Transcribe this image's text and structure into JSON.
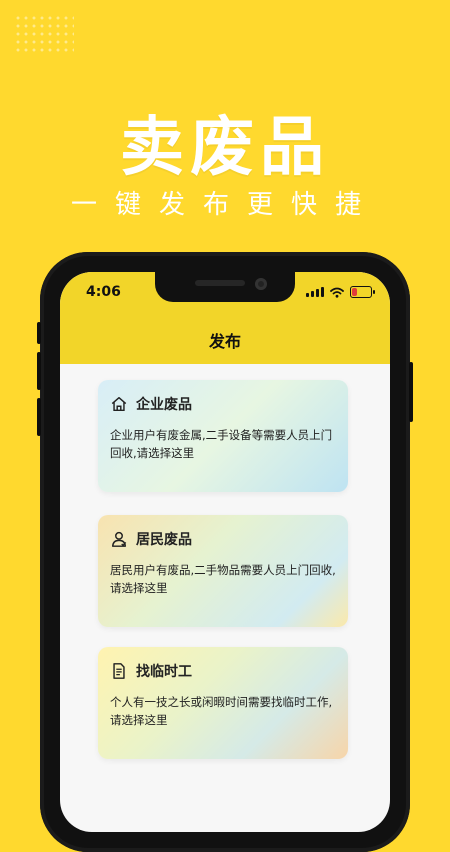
{
  "promo": {
    "headline": "卖废品",
    "subline": "一键发布更快捷"
  },
  "status_bar": {
    "time": "4:06",
    "icons": [
      "signal-icon",
      "wifi-icon",
      "battery-icon"
    ],
    "battery_color": "#E03B3B",
    "battery_level": 0.3
  },
  "header": {
    "title": "发布"
  },
  "cards": [
    {
      "title": "企业废品",
      "icon": "house-icon",
      "desc": "企业用户有废金属,二手设备等需要人员上门回收,请选择这里"
    },
    {
      "title": "居民废品",
      "icon": "person-icon",
      "desc": "居民用户有废品,二手物品需要人员上门回收,请选择这里"
    },
    {
      "title": "找临时工",
      "icon": "document-icon",
      "desc": "个人有一技之长或闲暇时间需要找临时工作,请选择这里"
    }
  ],
  "colors": {
    "background": "#FFD92E",
    "header": "#F2D529"
  }
}
